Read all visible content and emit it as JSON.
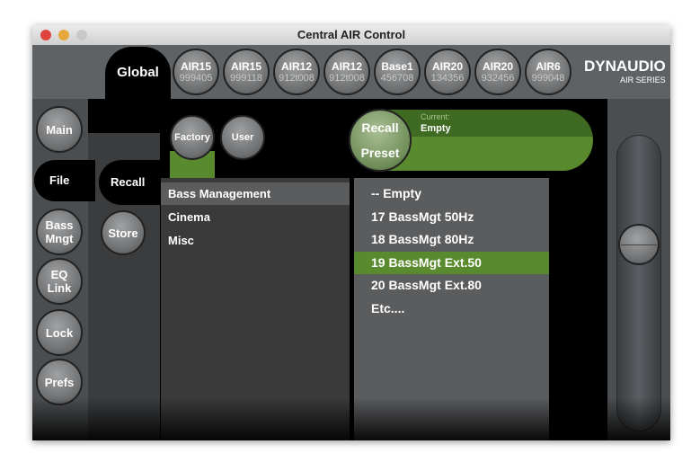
{
  "window": {
    "title": "Central AIR Control"
  },
  "top_tabs": {
    "global": "Global",
    "devices": [
      {
        "model": "AIR15",
        "serial": "999405"
      },
      {
        "model": "AIR15",
        "serial": "999118"
      },
      {
        "model": "AIR12",
        "serial": "912t008"
      },
      {
        "model": "AIR12",
        "serial": "912t008"
      },
      {
        "model": "Base1",
        "serial": "456708"
      },
      {
        "model": "AIR20",
        "serial": "134356"
      },
      {
        "model": "AIR20",
        "serial": "932456"
      },
      {
        "model": "AIR6",
        "serial": "999048"
      }
    ]
  },
  "logo": {
    "brand": "DYNAUDIO",
    "sub": "AIR SERIES"
  },
  "sidebar": {
    "items": [
      "Main",
      "File",
      "Bass Mngt",
      "EQ Link",
      "Lock",
      "Prefs"
    ],
    "selected": "File"
  },
  "file_tabs": {
    "recall": "Recall",
    "store": "Store"
  },
  "source": {
    "factory": "Factory",
    "user": "User",
    "selected": "Factory"
  },
  "recall_preset": {
    "line1": "Recall",
    "line2": "Preset",
    "current_label": "Current:",
    "current_value": "Empty"
  },
  "categories": {
    "items": [
      "Bass Management",
      "Cinema",
      "Misc"
    ],
    "selected": "Bass Management"
  },
  "presets": {
    "items": [
      "-- Empty",
      "17 BassMgt 50Hz",
      "18 BassMgt 80Hz",
      "19 BassMgt Ext.50",
      "20 BassMgt Ext.80",
      "Etc...."
    ],
    "selected": "19 BassMgt Ext.50"
  },
  "colors": {
    "accent_green": "#5a8a2e",
    "dark_green": "#3f6a22",
    "panel_gray": "#5e6265"
  },
  "slider": {
    "value_fraction": 0.35
  }
}
